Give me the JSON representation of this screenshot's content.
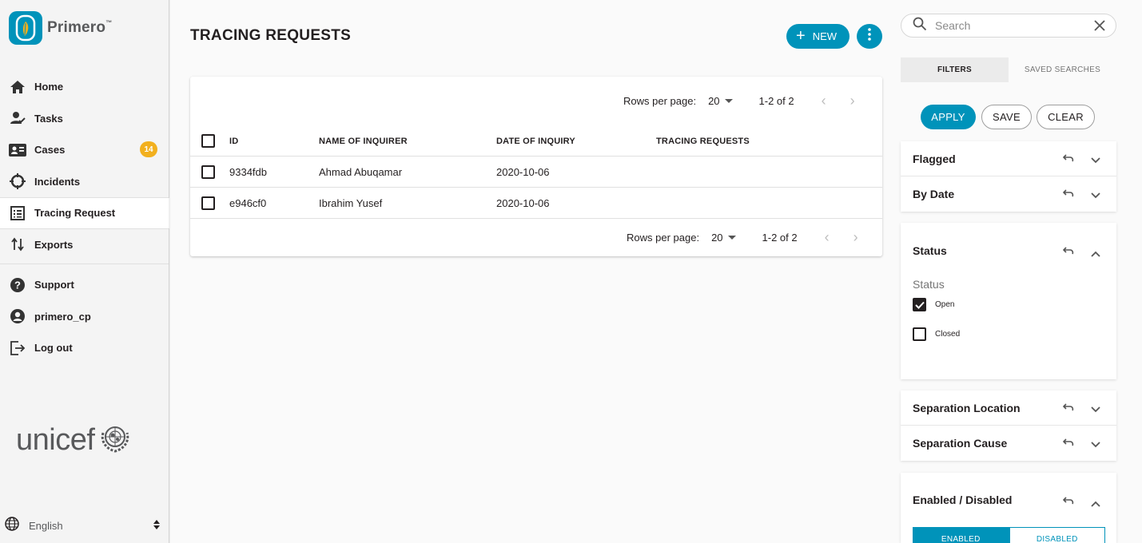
{
  "brand": {
    "name": "Primero",
    "tm": "™"
  },
  "sidebar": {
    "items": [
      {
        "label": "Home",
        "icon": "home-icon"
      },
      {
        "label": "Tasks",
        "icon": "tasks-icon"
      },
      {
        "label": "Cases",
        "icon": "cases-icon",
        "badge": "14"
      },
      {
        "label": "Incidents",
        "icon": "incidents-icon"
      },
      {
        "label": "Tracing Request",
        "icon": "tracing-request-icon",
        "active": true
      },
      {
        "label": "Exports",
        "icon": "exports-icon"
      }
    ],
    "bottom_items": [
      {
        "label": "Support",
        "icon": "help-icon"
      },
      {
        "label": "primero_cp",
        "icon": "account-icon"
      },
      {
        "label": "Log out",
        "icon": "logout-icon"
      }
    ],
    "partner_logo": "unicef",
    "language": "English"
  },
  "header": {
    "title": "TRACING REQUESTS",
    "new_label": "NEW"
  },
  "table": {
    "rows_per_page_label": "Rows per page:",
    "rows_per_page": "20",
    "range": "1-2 of 2",
    "columns": [
      "ID",
      "NAME OF INQUIRER",
      "DATE OF INQUIRY",
      "TRACING REQUESTS"
    ],
    "rows": [
      {
        "id": "9334fdb",
        "name": "Ahmad Abuqamar",
        "date": "2020-10-06",
        "tracing": ""
      },
      {
        "id": "e946cf0",
        "name": "Ibrahim Yusef",
        "date": "2020-10-06",
        "tracing": ""
      }
    ]
  },
  "search": {
    "placeholder": "Search"
  },
  "filters": {
    "tabs": [
      "FILTERS",
      "SAVED SEARCHES"
    ],
    "buttons": {
      "apply": "APPLY",
      "save": "SAVE",
      "clear": "CLEAR"
    },
    "panels": {
      "flagged": "Flagged",
      "by_date": "By Date",
      "status": "Status",
      "status_sub": "Status",
      "status_options": [
        {
          "label": "Open",
          "checked": true
        },
        {
          "label": "Closed",
          "checked": false
        }
      ],
      "separation_location": "Separation Location",
      "separation_cause": "Separation Cause",
      "enabled_disabled": "Enabled / Disabled",
      "toggle": [
        "ENABLED",
        "DISABLED"
      ]
    }
  },
  "colors": {
    "accent": "#0093ba",
    "badge": "#f2b01e",
    "text": "#231f20"
  }
}
